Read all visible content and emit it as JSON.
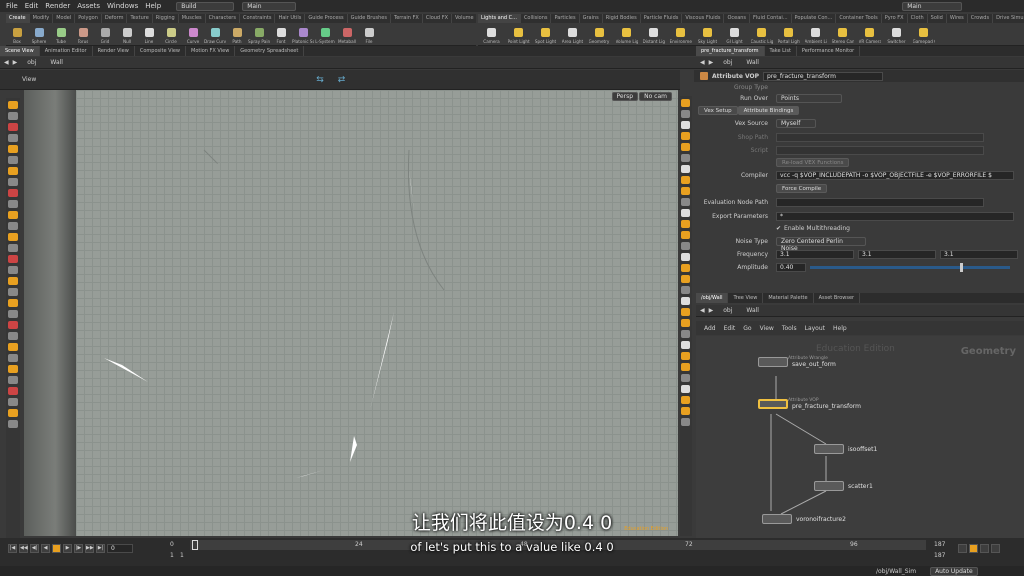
{
  "menu": [
    "File",
    "Edit",
    "Render",
    "Assets",
    "Windows",
    "Help"
  ],
  "desktop_left": "Build",
  "desktop_main": "Main",
  "desktop_right": "Main",
  "shelf_tabs_left": [
    "Create",
    "Modify",
    "Model",
    "Polygon",
    "Deform",
    "Texture",
    "Rigging",
    "Muscles",
    "Characters",
    "Constraints",
    "Hair Utils",
    "Guide Process",
    "Guide Brushes",
    "Terrain FX",
    "Cloud FX",
    "Volume"
  ],
  "shelf_tabs_right": [
    "Lights and C...",
    "Collisions",
    "Particles",
    "Grains",
    "Rigid Bodies",
    "Particle Fluids",
    "Viscous Fluids",
    "Oceans",
    "Fluid Contai...",
    "Populate Con...",
    "Container Tools",
    "Pyro FX",
    "Cloth",
    "Solid",
    "Wires",
    "Crowds",
    "Drive Simula..."
  ],
  "tools_left": [
    "Box",
    "Sphere",
    "Tube",
    "Torus",
    "Grid",
    "Null",
    "Line",
    "Circle",
    "Curve",
    "Draw Curve",
    "Path",
    "Spray Paint",
    "Font",
    "Platonic Solids",
    "L-System",
    "Metaball",
    "File"
  ],
  "tools_right": [
    "Camera",
    "Point Light",
    "Spot Light",
    "Area Light",
    "Geometry Light",
    "Volume Light",
    "Distant Light",
    "Environment Light",
    "Sky Light",
    "GI Light",
    "Caustic Light",
    "Portal Light",
    "Ambient Light",
    "Stereo Camera",
    "VR Camera",
    "Switcher",
    "Gamepad Camera"
  ],
  "pane_tabs_left": [
    "Scene View",
    "Animation Editor",
    "Render View",
    "Composite View",
    "Motion FX View",
    "Geometry Spreadsheet"
  ],
  "pane_tabs_right": [
    "pre_fracture_transform",
    "Take List",
    "Performance Monitor"
  ],
  "path_obj": "obj",
  "path_node": "Wall",
  "viewport": {
    "title": "View",
    "persp": "Persp",
    "cam": "No cam",
    "watermark": "Education Edition"
  },
  "vop": {
    "type": "Attribute VOP",
    "name": "pre_fracture_transform",
    "group_type": "Group Type",
    "run_over_label": "Run Over",
    "run_over": "Points",
    "tab1": "Vex Setup",
    "tab2": "Attribute Bindings",
    "vex_source_label": "Vex Source",
    "vex_source": "Myself",
    "shop_path": "Shop Path",
    "script": "Script",
    "reload": "Re-load VEX Functions",
    "compiler_label": "Compiler",
    "compiler": "vcc -q $VOP_INCLUDEPATH -o $VOP_OBJECTFILE -e $VOP_ERRORFILE $",
    "force_compile": "Force Compile",
    "eval_node_label": "Evaluation Node Path",
    "export_label": "Export Parameters",
    "export_value": "*",
    "multithread": "Enable Multithreading",
    "noise_type_label": "Noise Type",
    "noise_type": "Zero Centered Perlin Noise",
    "freq_label": "Frequency",
    "freq": [
      "3.1",
      "3.1",
      "3.1"
    ],
    "amp_label": "Amplitude",
    "amp": "0.40"
  },
  "net_tabs": [
    "/obj/Wall",
    "Tree View",
    "Material Palette",
    "Asset Browser"
  ],
  "net_menu": [
    "Add",
    "Edit",
    "Go",
    "View",
    "Tools",
    "Layout",
    "Help"
  ],
  "network": {
    "edu": "Education Edition",
    "ctx": "Geometry",
    "nodes": [
      {
        "sub": "Attribute Wrangle",
        "label": "save_out_form"
      },
      {
        "sub": "Attribute VOP",
        "label": "pre_fracture_transform"
      },
      {
        "sub": "",
        "label": "isooffset1"
      },
      {
        "sub": "",
        "label": "scatter1"
      },
      {
        "sub": "",
        "label": "voronoifracture2"
      }
    ]
  },
  "timeline": {
    "frame": "0",
    "start": "0",
    "ticks": [
      "24",
      "48",
      "72",
      "96"
    ],
    "end1": "187",
    "end2": "187",
    "start2": "1",
    "start3": "1"
  },
  "status": {
    "path": "/obj/Wall_Sim",
    "update": "Auto Update"
  },
  "subtitle_zh": "让我们将此值设为0.4 0",
  "subtitle_en": "of let's put this to a value like 0.4 0",
  "colors": {
    "accent": "#e8a020",
    "node_select": "#f0c040"
  }
}
